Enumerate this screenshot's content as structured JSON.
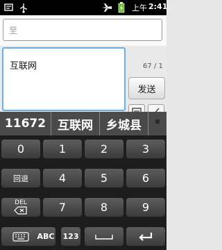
{
  "status_bar": {
    "ampm": "上午",
    "time": "2:41"
  },
  "recipient": {
    "placeholder": "至"
  },
  "compose": {
    "message": "互联网",
    "char_count": "67 / 1",
    "send_label": "发送"
  },
  "candidates": [
    "11672",
    "互联网",
    "乡城县"
  ],
  "keypad": {
    "row1": [
      "0",
      "1",
      "2",
      "3"
    ],
    "row2": [
      "回退",
      "4",
      "5",
      "6"
    ],
    "row3_del": "DEL",
    "row3": [
      "7",
      "8",
      "9"
    ],
    "row4_abc": "ABC",
    "row4_123": "123"
  },
  "icons": {
    "status": [
      "notification-icon",
      "usb-icon",
      "airplane-icon",
      "battery-icon"
    ],
    "compose": [
      "attach-photo-icon",
      "attach-clip-icon"
    ],
    "keypad": [
      "backspace-icon",
      "keyboard-icon",
      "space-icon",
      "enter-icon"
    ]
  }
}
